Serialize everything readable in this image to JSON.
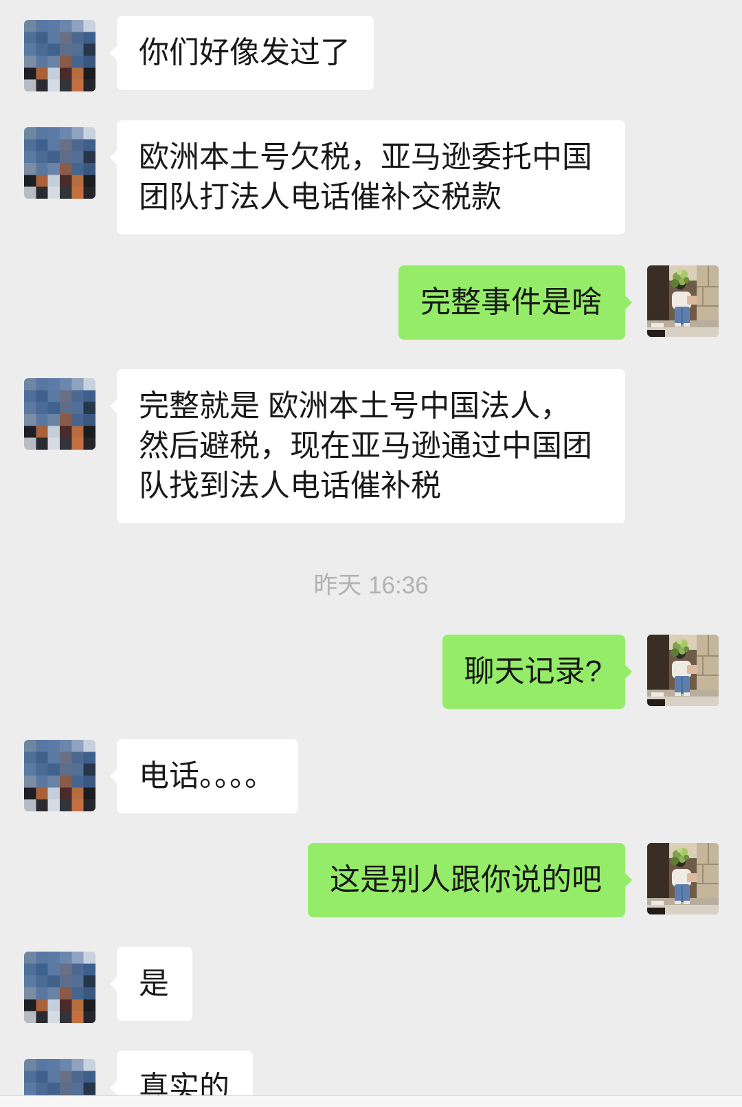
{
  "chat": {
    "items": [
      {
        "outgoing": false,
        "text": "你们好像发过了"
      },
      {
        "outgoing": false,
        "text": "欧洲本土号欠税，亚马逊委托中国团队打法人电话催补交税款"
      },
      {
        "outgoing": true,
        "text": "完整事件是啥"
      },
      {
        "outgoing": false,
        "text": "完整就是 欧洲本土号中国法人，然后避税，现在亚马逊通过中国团队找到法人电话催补税"
      },
      {
        "time": "昨天 16:36"
      },
      {
        "outgoing": true,
        "text": "聊天记录?"
      },
      {
        "outgoing": false,
        "text": "电话。。。。"
      },
      {
        "outgoing": true,
        "text": "这是别人跟你说的吧"
      },
      {
        "outgoing": false,
        "text": "是"
      },
      {
        "outgoing": false,
        "text": "真实的"
      }
    ]
  },
  "colors": {
    "background": "#ededed",
    "incoming_bubble": "#ffffff",
    "outgoing_bubble": "#95ec69",
    "timestamp_text": "#b2b2b2"
  }
}
